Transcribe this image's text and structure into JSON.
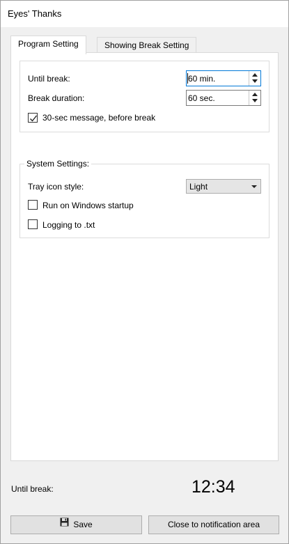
{
  "window": {
    "title": "Eyes' Thanks"
  },
  "tabs": [
    {
      "label": "Program Setting",
      "active": true
    },
    {
      "label": "Showing Break Setting",
      "active": false
    }
  ],
  "program": {
    "until_break_label": "Until break:",
    "until_break_value": "60 min.",
    "break_duration_label": "Break duration:",
    "break_duration_value": "60 sec.",
    "message_label": "30-sec message, before break",
    "message_checked": true
  },
  "system": {
    "legend": "System Settings:",
    "tray_label": "Tray icon style:",
    "tray_value": "Light",
    "startup_label": "Run on Windows startup",
    "startup_checked": false,
    "logging_label": "Logging to .txt",
    "logging_checked": false
  },
  "footer": {
    "until_break_label": "Until break:",
    "countdown": "12:34",
    "save_label": "Save",
    "close_label": "Close to notification area"
  },
  "icons": {
    "save": "floppy-disk-icon",
    "check": "checkmark-icon"
  },
  "colors": {
    "window_bg": "#f0f0f0",
    "panel_bg": "#ffffff",
    "focus_border": "#0078d7",
    "button_bg": "#e1e1e1"
  }
}
